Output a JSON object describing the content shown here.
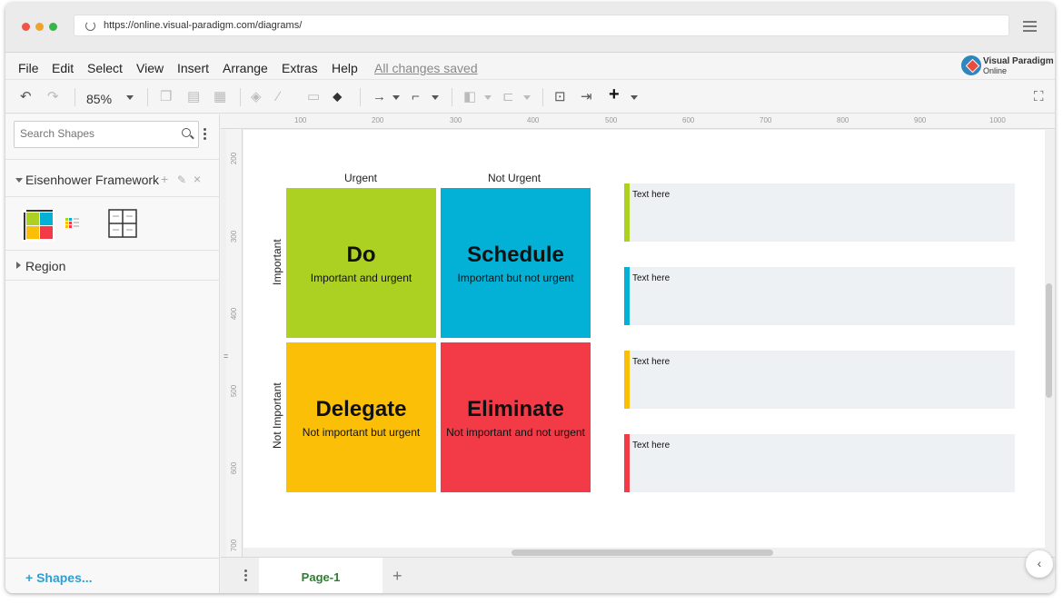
{
  "browser": {
    "url": "https://online.visual-paradigm.com/diagrams/"
  },
  "menu": {
    "items": [
      "File",
      "Edit",
      "Select",
      "View",
      "Insert",
      "Arrange",
      "Extras",
      "Help"
    ],
    "status": "All changes saved",
    "brand_line1": "Visual Paradigm",
    "brand_line2": "Online"
  },
  "toolbar": {
    "zoom": "85%"
  },
  "sidebar": {
    "search_placeholder": "Search Shapes",
    "section_title": "Eisenhower Framework",
    "region_label": "Region",
    "shapes_link": "+ Shapes..."
  },
  "rulers": {
    "top": [
      "100",
      "200",
      "300",
      "400",
      "500",
      "600",
      "700",
      "800",
      "900",
      "1000"
    ],
    "left": [
      "200",
      "300",
      "400",
      "500",
      "600",
      "700"
    ]
  },
  "matrix": {
    "col_headers": [
      "Urgent",
      "Not Urgent"
    ],
    "row_headers": [
      "Important",
      "Not Important"
    ],
    "quadrants": [
      {
        "title": "Do",
        "subtitle": "Important and urgent",
        "color": "#acd122"
      },
      {
        "title": "Schedule",
        "subtitle": "Important but not urgent",
        "color": "#03b0d6"
      },
      {
        "title": "Delegate",
        "subtitle": "Not important but urgent",
        "color": "#fbbf08"
      },
      {
        "title": "Eliminate",
        "subtitle": "Not important and not urgent",
        "color": "#f23b47"
      }
    ]
  },
  "notes": [
    {
      "text": "Text here",
      "color": "#acd122"
    },
    {
      "text": "Text here",
      "color": "#03b0d6"
    },
    {
      "text": "Text here",
      "color": "#fbbf08"
    },
    {
      "text": "Text here",
      "color": "#f23b47"
    }
  ],
  "tabs": {
    "page_tab": "Page-1"
  },
  "icons": [
    "reload-icon",
    "hamburger-icon",
    "undo-icon",
    "redo-icon",
    "copy-icon",
    "paste-icon",
    "delete-icon",
    "fill-icon",
    "line-color-icon",
    "shadow-icon",
    "format-painter-icon",
    "connector-icon",
    "waypoint-icon",
    "to-front-icon",
    "align-icon",
    "fit-icon",
    "insert-icon",
    "plus-icon",
    "fullscreen-icon",
    "search-icon",
    "more-icon",
    "edit-icon",
    "close-icon",
    "chevron-left-icon"
  ]
}
